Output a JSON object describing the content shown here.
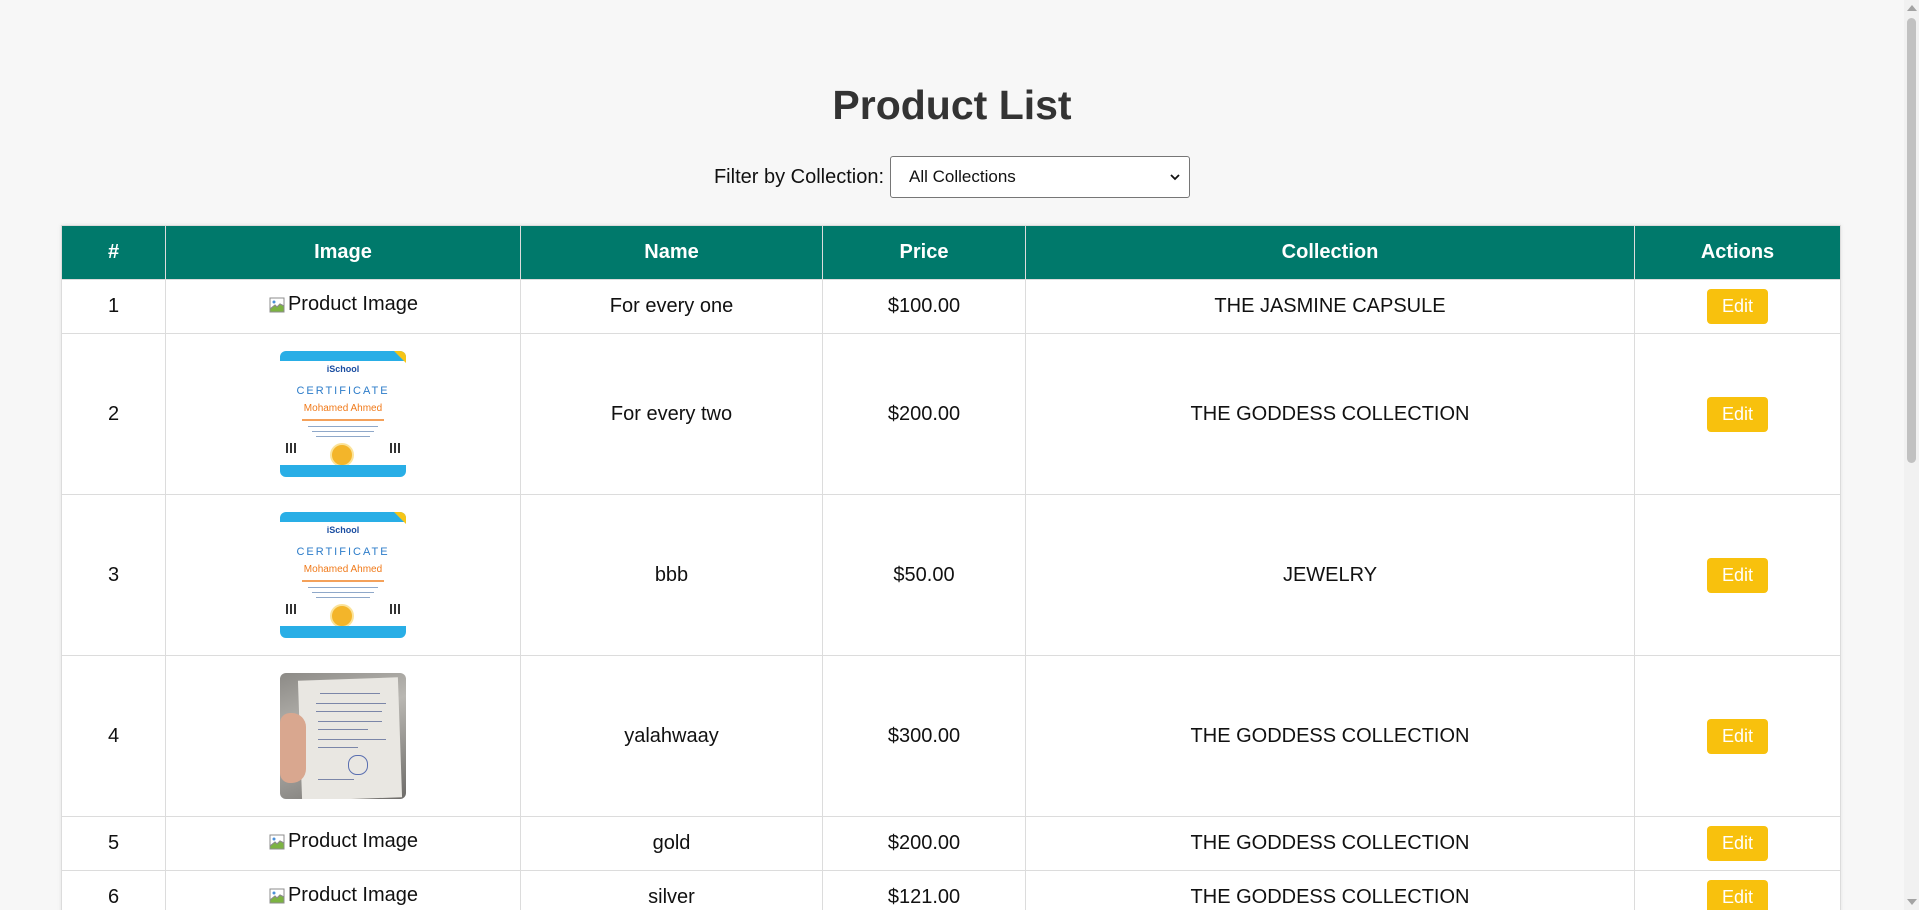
{
  "page": {
    "title": "Product List"
  },
  "filter": {
    "label": "Filter by Collection:",
    "selected": "All Collections"
  },
  "table": {
    "headers": [
      "#",
      "Image",
      "Name",
      "Price",
      "Collection",
      "Actions"
    ],
    "rows": [
      {
        "num": "1",
        "image_type": "broken",
        "image_alt": "Product Image",
        "name": "For every one",
        "price": "$100.00",
        "collection": "THE JASMINE CAPSULE",
        "action": "Edit"
      },
      {
        "num": "2",
        "image_type": "certificate",
        "image_alt": "Product Image",
        "name": "For every two",
        "price": "$200.00",
        "collection": "THE GODDESS COLLECTION",
        "action": "Edit"
      },
      {
        "num": "3",
        "image_type": "certificate",
        "image_alt": "Product Image",
        "name": "bbb",
        "price": "$50.00",
        "collection": "JEWELRY",
        "action": "Edit"
      },
      {
        "num": "4",
        "image_type": "photo",
        "image_alt": "Product Image",
        "name": "yalahwaay",
        "price": "$300.00",
        "collection": "THE GODDESS COLLECTION",
        "action": "Edit"
      },
      {
        "num": "5",
        "image_type": "broken",
        "image_alt": "Product Image",
        "name": "gold",
        "price": "$200.00",
        "collection": "THE GODDESS COLLECTION",
        "action": "Edit"
      },
      {
        "num": "6",
        "image_type": "broken",
        "image_alt": "Product Image",
        "name": "silver",
        "price": "$121.00",
        "collection": "THE GODDESS COLLECTION",
        "action": "Edit"
      }
    ]
  },
  "certificate_image": {
    "brand": "iSchool",
    "title": "CERTIFICATE",
    "person": "Mohamed Ahmed"
  },
  "colors": {
    "header_bg": "#00796b",
    "edit_button": "#f8c10d",
    "page_bg": "#f7f7f7"
  },
  "icons": {
    "broken_image": "broken-image-icon",
    "select_chevron": "chevron-down-icon"
  }
}
